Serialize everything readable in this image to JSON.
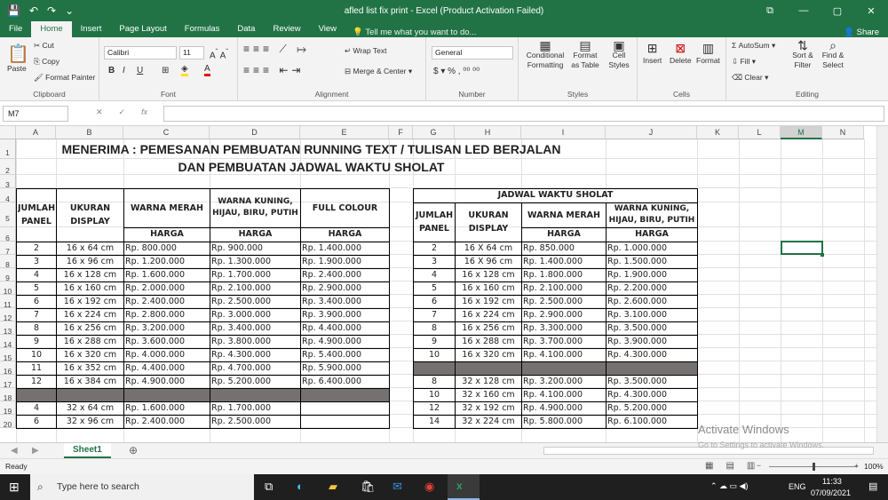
{
  "window": {
    "title": "afled list fix print  -  Excel (Product Activation Failed)",
    "min": "—",
    "max": "▢",
    "close": "✕"
  },
  "tabs": [
    "File",
    "Home",
    "Insert",
    "Page Layout",
    "Formulas",
    "Data",
    "Review",
    "View"
  ],
  "tell_me": "Tell me what you want to do...",
  "share": "Share",
  "ribbon": {
    "clipboard": {
      "paste": "Paste",
      "cut": "Cut",
      "copy": "Copy",
      "painter": "Format Painter",
      "label": "Clipboard"
    },
    "font": {
      "name": "Calibri",
      "size": "11",
      "label": "Font",
      "bold": "B",
      "italic": "I",
      "underline": "U"
    },
    "alignment": {
      "wrap": "Wrap Text",
      "merge": "Merge & Center",
      "label": "Alignment"
    },
    "number": {
      "format": "General",
      "label": "Number"
    },
    "styles": {
      "cond": "Conditional Formatting",
      "table": "Format as Table",
      "cell": "Cell Styles",
      "label": "Styles"
    },
    "cells": {
      "insert": "Insert",
      "delete": "Delete",
      "format": "Format",
      "label": "Cells"
    },
    "editing": {
      "autosum": "AutoSum",
      "fill": "Fill",
      "clear": "Clear",
      "sort": "Sort & Filter",
      "find": "Find & Select",
      "label": "Editing"
    }
  },
  "formula_bar": {
    "name_box": "M7",
    "fx": "fx",
    "value": ""
  },
  "columns": [
    "A",
    "B",
    "C",
    "D",
    "E",
    "F",
    "G",
    "H",
    "I",
    "J",
    "K",
    "L",
    "M",
    "N"
  ],
  "rows": [
    "1",
    "2",
    "3",
    "4",
    "5",
    "6",
    "7",
    "8",
    "9",
    "10",
    "11",
    "12",
    "13",
    "14",
    "15",
    "16",
    "17",
    "18",
    "19",
    "20"
  ],
  "sheet": {
    "title1": "MENERIMA : PEMESANAN PEMBUATAN RUNNING TEXT / TULISAN LED BERJALAN",
    "title2": "DAN PEMBUATAN JADWAL  WAKTU SHOLAT",
    "left_headers": {
      "jumlah": "JUMLAH PANEL",
      "ukuran": "UKURAN DISPLAY",
      "merah": "WARNA MERAH",
      "kuning": "WARNA KUNING, HIJAU, BIRU, PUTIH",
      "full": "FULL COLOUR",
      "harga": "HARGA"
    },
    "left_rows": [
      [
        "2",
        "16 x 64 cm",
        "Rp. 800.000",
        "Rp. 900.000",
        "Rp. 1.400.000"
      ],
      [
        "3",
        "16 x 96 cm",
        "Rp. 1.200.000",
        "Rp. 1.300.000",
        "Rp. 1.900.000"
      ],
      [
        "4",
        "16 x 128 cm",
        "Rp. 1.600.000",
        "Rp. 1.700.000",
        "Rp. 2.400.000"
      ],
      [
        "5",
        "16 x 160 cm",
        "Rp. 2.000.000",
        "Rp. 2.100.000",
        "Rp. 2.900.000"
      ],
      [
        "6",
        "16 x 192 cm",
        "Rp. 2.400.000",
        "Rp. 2.500.000",
        "Rp. 3.400.000"
      ],
      [
        "7",
        "16 x 224 cm",
        "Rp. 2.800.000",
        "Rp. 3.000.000",
        "Rp. 3.900.000"
      ],
      [
        "8",
        "16 x 256 cm",
        "Rp. 3.200.000",
        "Rp. 3.400.000",
        "Rp. 4.400.000"
      ],
      [
        "9",
        "16 x 288 cm",
        "Rp. 3.600.000",
        "Rp. 3.800.000",
        "Rp. 4.900.000"
      ],
      [
        "10",
        "16 x 320 cm",
        "Rp. 4.000.000",
        "Rp. 4.300.000",
        "Rp. 5.400.000"
      ],
      [
        "11",
        "16 x 352 cm",
        "Rp. 4.400.000",
        "Rp. 4.700.000",
        "Rp. 5.900.000"
      ],
      [
        "12",
        "16 x 384 cm",
        "Rp. 4.900.000",
        "Rp. 5.200.000",
        "Rp. 6.400.000"
      ],
      null,
      [
        "4",
        "32 x 64 cm",
        "Rp. 1.600.000",
        "Rp. 1.700.000",
        ""
      ],
      [
        "6",
        "32 x 96 cm",
        "Rp. 2.400.000",
        "Rp. 2.500.000",
        ""
      ]
    ],
    "right_title": "JADWAL WAKTU SHOLAT",
    "right_headers": {
      "jumlah": "JUMLAH PANEL",
      "ukuran": "UKURAN DISPLAY",
      "merah": "WARNA MERAH",
      "kuning": "WARNA KUNING, HIJAU, BIRU, PUTIH",
      "harga": "HARGA"
    },
    "right_rows": [
      [
        "2",
        "16 X 64 cm",
        "Rp. 850.000",
        "Rp. 1.000.000"
      ],
      [
        "3",
        "16 X 96 cm",
        "Rp. 1.400.000",
        "Rp. 1.500.000"
      ],
      [
        "4",
        "16 x 128 cm",
        "Rp. 1.800.000",
        "Rp. 1.900.000"
      ],
      [
        "5",
        "16 x 160 cm",
        "Rp. 2.100.000",
        "Rp. 2.200.000"
      ],
      [
        "6",
        "16 x 192 cm",
        "Rp. 2.500.000",
        "Rp. 2.600.000"
      ],
      [
        "7",
        "16 x 224 cm",
        "Rp. 2.900.000",
        "Rp. 3.100.000"
      ],
      [
        "8",
        "16 x 256 cm",
        "Rp. 3.300.000",
        "Rp. 3.500.000"
      ],
      [
        "9",
        "16 x 288 cm",
        "Rp. 3.700.000",
        "Rp. 3.900.000"
      ],
      [
        "10",
        "16 x 320 cm",
        "Rp. 4.100.000",
        "Rp. 4.300.000"
      ],
      null,
      [
        "8",
        "32 x 128 cm",
        "Rp. 3.200.000",
        "Rp. 3.500.000"
      ],
      [
        "10",
        "32 x 160 cm",
        "Rp. 4.100.000",
        "Rp. 4.300.000"
      ],
      [
        "12",
        "32 x 192 cm",
        "Rp. 4.900.000",
        "Rp. 5.200.000"
      ],
      [
        "14",
        "32 x 224 cm",
        "Rp. 5.800.000",
        "Rp. 6.100.000"
      ]
    ]
  },
  "sheet_tab": "Sheet1",
  "status": {
    "ready": "Ready",
    "zoom": "100%"
  },
  "activation": {
    "line1": "Activate Windows",
    "line2": "Go to Settings to activate Windows."
  },
  "taskbar": {
    "search": "Type here to search",
    "lang": "ENG",
    "time": "11:33",
    "date": "07/09/2021"
  },
  "colors": {
    "excel_green": "#217346",
    "shade": "#757171"
  }
}
